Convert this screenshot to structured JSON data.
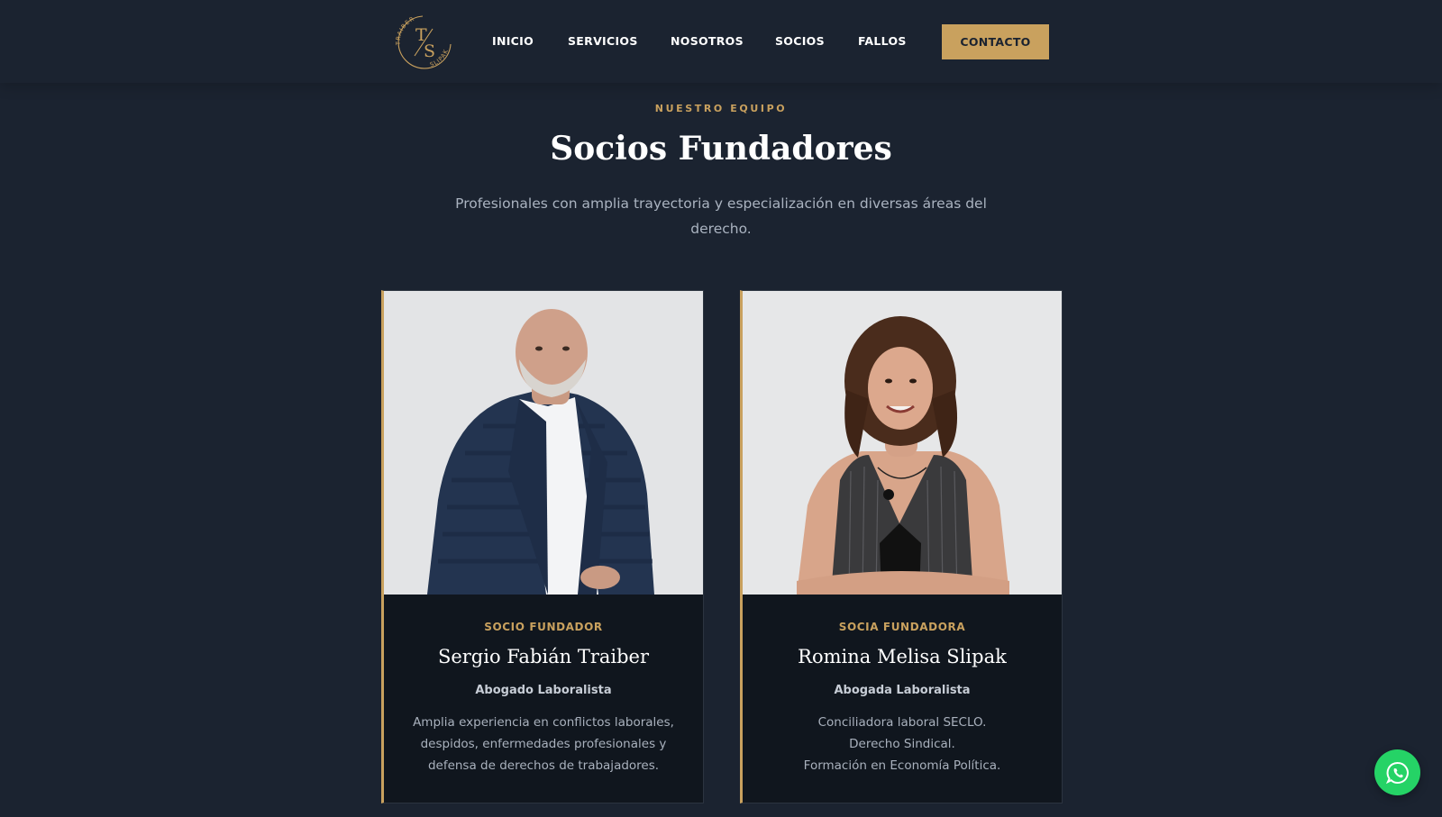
{
  "header": {
    "logo": {
      "top_text": "TRAIBER",
      "bottom_text": "SLIPAK",
      "monogram_t": "T",
      "monogram_s": "S"
    },
    "nav": [
      {
        "label": "INICIO"
      },
      {
        "label": "SERVICIOS"
      },
      {
        "label": "NOSOTROS"
      },
      {
        "label": "SOCIOS"
      },
      {
        "label": "FALLOS"
      }
    ],
    "contact_label": "CONTACTO"
  },
  "section": {
    "eyebrow": "NUESTRO EQUIPO",
    "title": "Socios Fundadores",
    "subtitle_line1": "Profesionales con amplia trayectoria y especialización en diversas áreas del",
    "subtitle_line2": "derecho."
  },
  "partners": [
    {
      "role": "SOCIO FUNDADOR",
      "name": "Sergio Fabián Traiber",
      "specialty": "Abogado Laboralista",
      "description": [
        "Amplia experiencia en conflictos laborales,",
        "despidos, enfermedades profesionales y",
        "defensa de derechos de trabajadores."
      ]
    },
    {
      "role": "SOCIA FUNDADORA",
      "name": "Romina Melisa Slipak",
      "specialty": "Abogada Laboralista",
      "description": [
        "Conciliadora laboral SECLO.",
        "Derecho Sindical.",
        "Formación en Economía Política."
      ]
    }
  ],
  "colors": {
    "background": "#1b2330",
    "accent_gold": "#c9a15e",
    "card_background": "#10161e",
    "whatsapp_green": "#25d366"
  },
  "icons": {
    "floating_button": "whatsapp-icon"
  }
}
